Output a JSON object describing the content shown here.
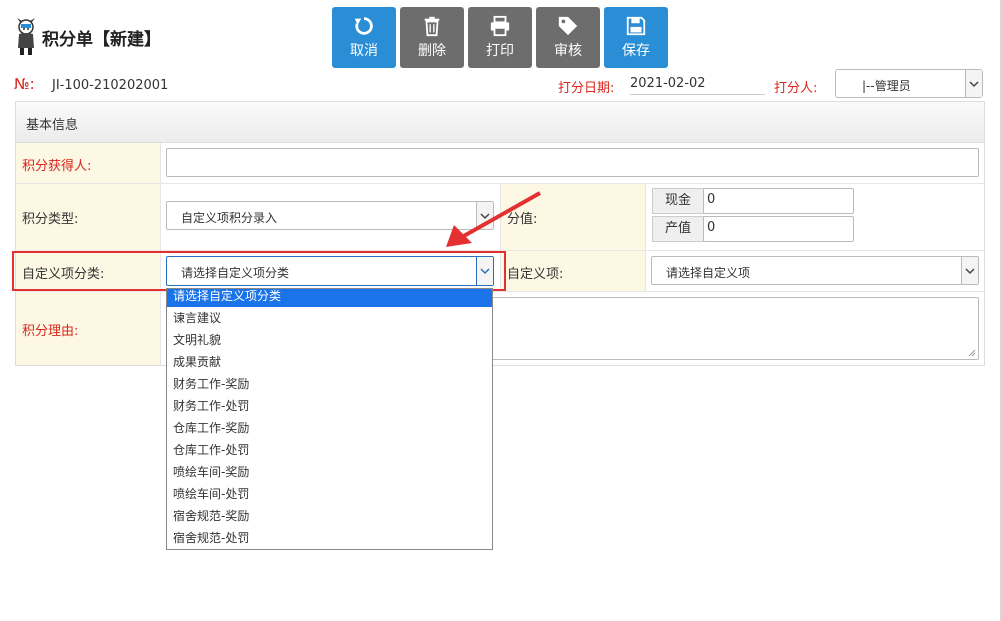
{
  "header": {
    "title": "积分单【新建】"
  },
  "toolbar": {
    "cancel": "取消",
    "delete": "删除",
    "print": "打印",
    "audit": "审核",
    "save": "保存"
  },
  "meta": {
    "no_label": "№:",
    "no_value": "JI-100-210202001",
    "date_label": "打分日期:",
    "date_value": "2021-02-02",
    "scorer_label": "打分人:",
    "scorer_value": "|--管理员"
  },
  "panel": {
    "title": "基本信息"
  },
  "form": {
    "recipient_label": "积分获得人:",
    "recipient_value": "",
    "type_label": "积分类型:",
    "type_value": "自定义项积分录入",
    "score_label": "分值:",
    "cash_label": "现金",
    "cash_value": "0",
    "output_label": "产值",
    "output_value": "0",
    "category_label": "自定义项分类:",
    "category_value": "请选择自定义项分类",
    "custom_label": "自定义项:",
    "custom_value": "请选择自定义项",
    "reason_label": "积分理由:"
  },
  "dropdown": {
    "items": [
      "请选择自定义项分类",
      "谏言建议",
      "文明礼貌",
      "成果贡献",
      "财务工作-奖励",
      "财务工作-处罚",
      "仓库工作-奖励",
      "仓库工作-处罚",
      "喷绘车间-奖励",
      "喷绘车间-处罚",
      "宿舍规范-奖励",
      "宿舍规范-处罚"
    ]
  },
  "colors": {
    "accent": "#2a8ed6",
    "required": "#d9261c",
    "highlight": "#e33030",
    "selected": "#1a73e8"
  }
}
